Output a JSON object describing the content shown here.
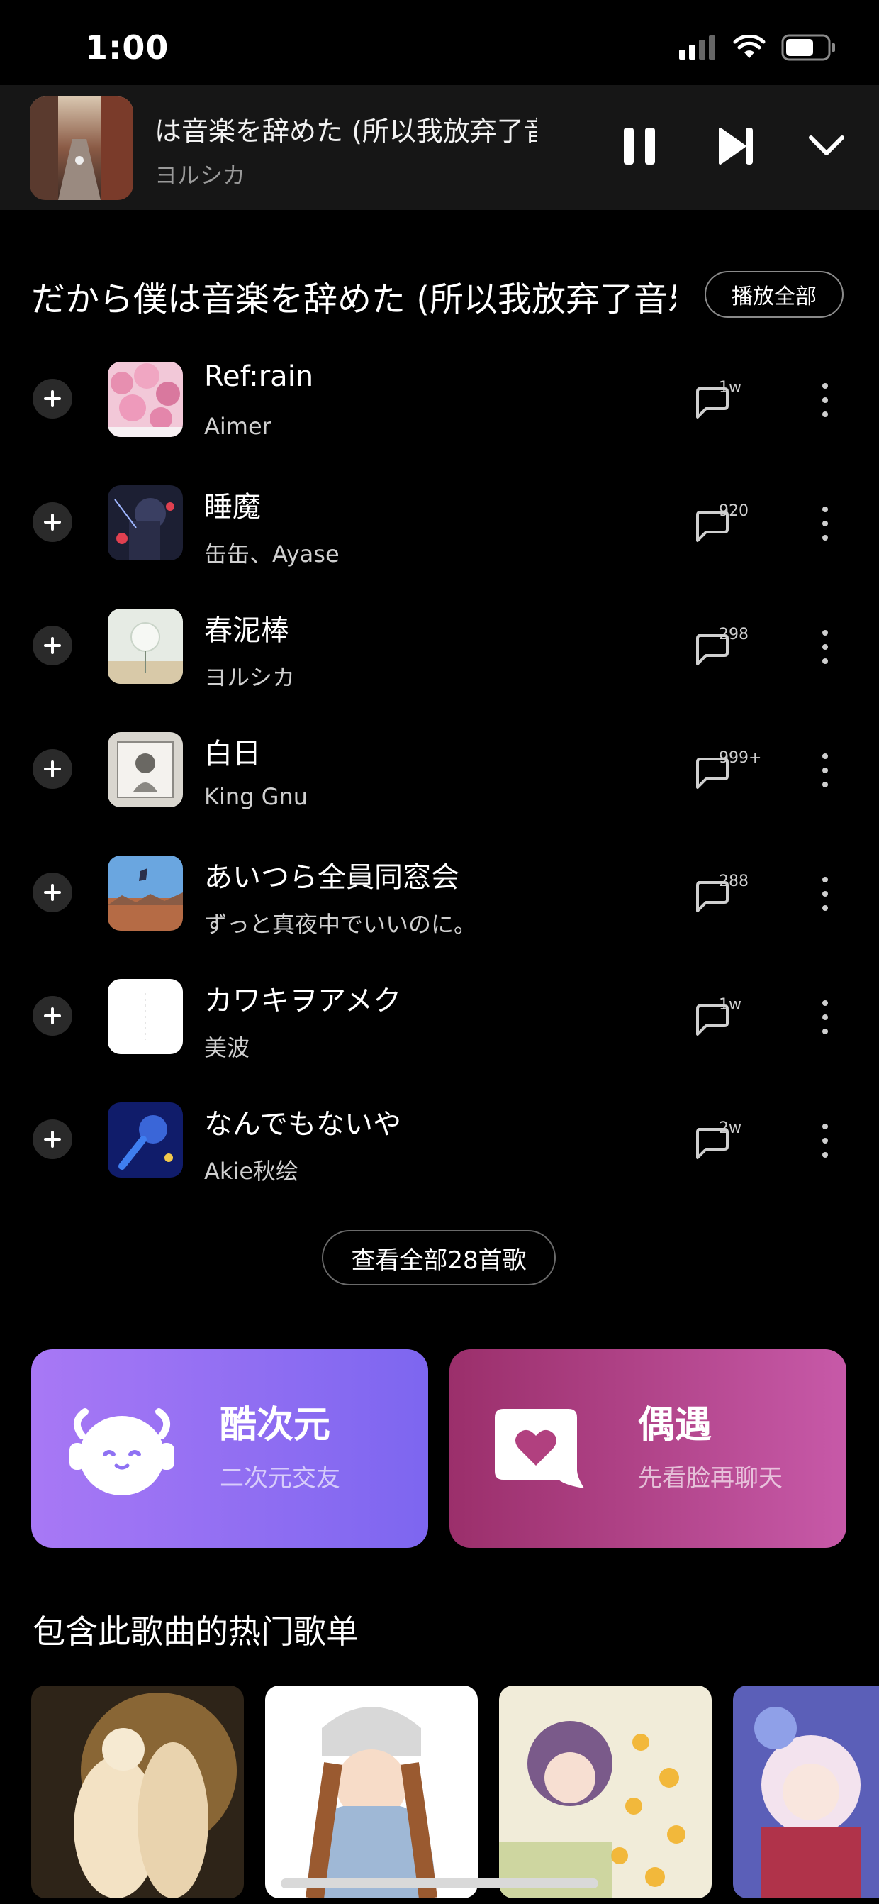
{
  "status_bar": {
    "time": "1:00",
    "icons": [
      "signal-icon",
      "wifi-icon",
      "battery-icon"
    ]
  },
  "player": {
    "title": "は音楽を辞めた (所以我放弃了音乐)",
    "artist": "ヨルシカ",
    "state": "playing"
  },
  "album_section": {
    "title": "だから僕は音楽を辞めた (所以我放弃了音乐)",
    "play_all_label": "播放全部"
  },
  "songs": [
    {
      "title": "Ref:rain",
      "artist": "Aimer",
      "comments": "1w"
    },
    {
      "title": "睡魔",
      "artist": "缶缶、Ayase",
      "comments": "920"
    },
    {
      "title": "春泥棒",
      "artist": "ヨルシカ",
      "comments": "298"
    },
    {
      "title": "白日",
      "artist": "King Gnu",
      "comments": "999+"
    },
    {
      "title": "あいつら全員同窓会",
      "artist": "ずっと真夜中でいいのに。",
      "comments": "288"
    },
    {
      "title": "カワキヲアメク",
      "artist": "美波",
      "comments": "1w"
    },
    {
      "title": "なんでもないや",
      "artist": "Akie秋绘",
      "comments": "2w"
    }
  ],
  "view_all_label": "查看全部28首歌",
  "promos": [
    {
      "title": "酷次元",
      "subtitle": "二次元交友"
    },
    {
      "title": "偶遇",
      "subtitle": "先看脸再聊天"
    }
  ],
  "playlists_section": {
    "title": "包含此歌曲的热门歌单"
  },
  "colors": {
    "background": "#000000",
    "player_bg": "#161616",
    "promo_left": "#8b6ef2",
    "promo_right": "#b54690"
  }
}
